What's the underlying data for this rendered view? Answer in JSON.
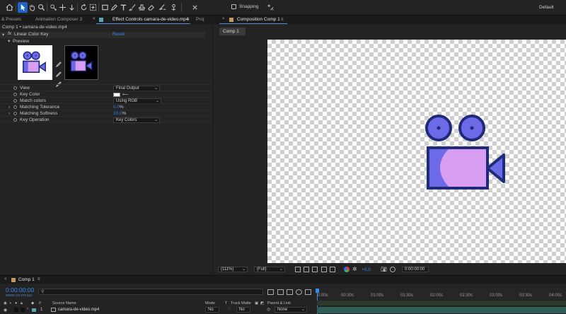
{
  "toolbar": {
    "snapping_label": "Snapping",
    "workspace_label": "Default"
  },
  "left_panel": {
    "tabs": [
      {
        "label": "& Presets"
      },
      {
        "label": "Animation Composer 3"
      },
      {
        "label": "Effect Controls camara-de-video.mp4"
      },
      {
        "label": "Proj"
      }
    ],
    "breadcrumb": "Comp 1 • camara-de-video.mp4",
    "effect": {
      "fx_label": "fx",
      "name": "Linear Color Key",
      "reset_label": "Reset",
      "preview_label": "Preview"
    },
    "properties": [
      {
        "label": "View",
        "value": "Final Output"
      },
      {
        "label": "Key Color",
        "value": ""
      },
      {
        "label": "Match colors",
        "value": "Using RGB"
      },
      {
        "label": "Matching Tolerance",
        "value": "0,0",
        "unit": "%"
      },
      {
        "label": "Matching Softness",
        "value": "10,0",
        "unit": "%"
      },
      {
        "label": "Key Operation",
        "value": "Key Colors"
      }
    ]
  },
  "right_panel": {
    "tab_label": "Composition Comp 1",
    "comp_tab": "Comp 1",
    "viewer_bar": {
      "zoom": "(111%)",
      "resolution": "(Full)",
      "exposure": "+0,0",
      "timecode": "0:00:00:00"
    }
  },
  "timeline": {
    "comp_tab": "Comp 1",
    "current_time": "0:00:00:00",
    "frame_info": "00000 (23.976 fps)",
    "search_placeholder": "",
    "ruler": [
      "0:00s",
      "00:30s",
      "01:00s",
      "01:30s",
      "02:00s",
      "02:30s",
      "03:00s",
      "03:30s",
      "04:00s"
    ],
    "columns": {
      "source_name": "Source Name",
      "mode": "Mode",
      "t": "T",
      "track_matte": "Track Matte",
      "parent_link": "Parent & Link"
    },
    "layer": {
      "number": "1",
      "name": "camara-de-video.mp4",
      "mode": "No",
      "track_matte": "No",
      "parent": "None"
    }
  },
  "colors": {
    "accent": "#2f8cf0",
    "camera_fill": "#6d6ae8",
    "camera_lens": "#d79ef2",
    "camera_outline": "#1f2a7a"
  }
}
